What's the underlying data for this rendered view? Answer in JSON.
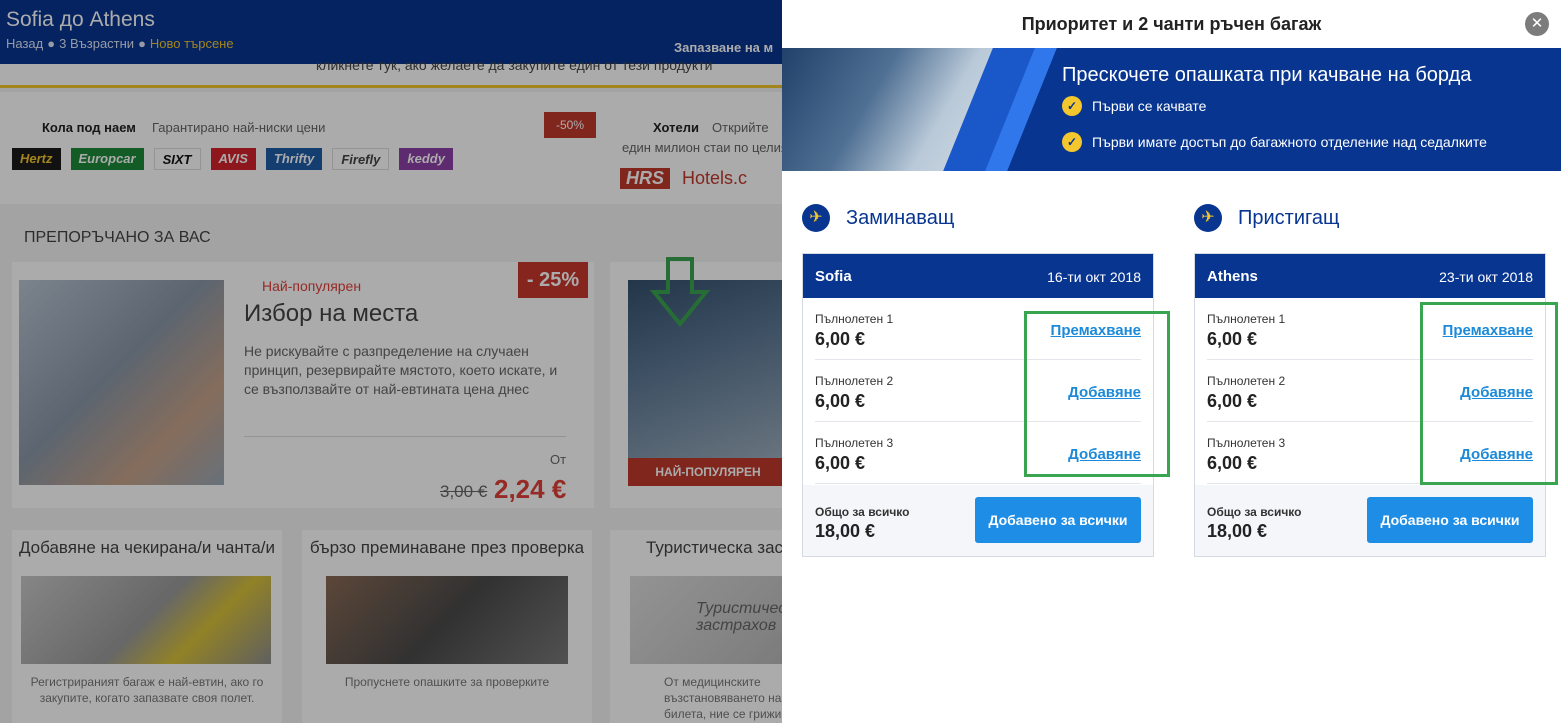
{
  "background": {
    "title": "Sofia до Athens",
    "crumbs": {
      "back": "Назад",
      "passengers": "3 Възрастни",
      "new_search": "Ново търсене"
    },
    "booking_label": "Запазване на м",
    "notice": "кликнете тук, ако желаете да закупите един от тези продукти",
    "car_hire": {
      "label": "Кола под наем",
      "subtitle": "Гарантирано най-ниски цени",
      "discount": "-50%",
      "brands": [
        {
          "name": "Hertz",
          "color": "#222222"
        },
        {
          "name": "Europcar",
          "color": "#1d8a3a"
        },
        {
          "name": "SIXT",
          "color": "#ffffff"
        },
        {
          "name": "AVIS",
          "color": "#d2232a"
        },
        {
          "name": "Thrifty",
          "color": "#1f5ba8"
        },
        {
          "name": "Firefly",
          "color": "#ffffff"
        },
        {
          "name": "keddy",
          "color": "#8c3fa8"
        }
      ]
    },
    "hotels": {
      "label": "Хотели",
      "subtitle": "Открийте",
      "subtitle2": "един милион стаи по целия",
      "logos": [
        "HRS",
        "Hotels.c"
      ]
    },
    "recommended_title": "ПРЕПОРЪЧАНО ЗА ВАС",
    "seat_card": {
      "badge": "Най-популярен",
      "discount": "- 25%",
      "title": "Избор на места",
      "description": "Не рискувайте с разпределение на случаен принцип, резервирайте мястото, което искате, и се възползвайте от най-евтината цена днес",
      "from_label": "От",
      "old_price": "3,00 €",
      "new_price": "2,24 €"
    },
    "bag_card": {
      "banner": "НАЙ-ПОПУЛЯРЕН"
    },
    "checked_bag_card": {
      "title": "Добавяне на чекирана/и чанта/и",
      "caption": "Регистрираният багаж е най-евтин, ако го закупите, когато запазвате своя полет."
    },
    "fast_track_card": {
      "title": "бързо преминаване през проверка",
      "caption": "Пропуснете опашките за проверките"
    },
    "insurance_card": {
      "title": "Туристическа зас",
      "caption": "От медицинските възстановяването на с билета, ние се грижи",
      "image_text": "Туристичес застрахов"
    }
  },
  "modal": {
    "title": "Приоритет и 2 чанти ръчен багаж",
    "close_label": "✕",
    "hero": {
      "headline": "Прескочете опашката при качване на борда",
      "benefits": [
        "Първи се качвате",
        "Първи имате достъп до багажното отделение над седалките"
      ]
    },
    "flights": [
      {
        "direction": "Заминаващ",
        "city": "Sofia",
        "date": "16-ти окт 2018",
        "passengers": [
          {
            "name": "Пълнолетен 1",
            "price": "6,00 €",
            "action": "Премахване"
          },
          {
            "name": "Пълнолетен 2",
            "price": "6,00 €",
            "action": "Добавяне"
          },
          {
            "name": "Пълнолетен 3",
            "price": "6,00 €",
            "action": "Добавяне"
          }
        ],
        "total_label": "Общо за всичко",
        "total": "18,00 €",
        "button": "Добавено за всички"
      },
      {
        "direction": "Пристигащ",
        "city": "Athens",
        "date": "23-ти окт 2018",
        "passengers": [
          {
            "name": "Пълнолетен 1",
            "price": "6,00 €",
            "action": "Премахване"
          },
          {
            "name": "Пълнолетен 2",
            "price": "6,00 €",
            "action": "Добавяне"
          },
          {
            "name": "Пълнолетен 3",
            "price": "6,00 €",
            "action": "Добавяне"
          }
        ],
        "total_label": "Общо за всичко",
        "total": "18,00 €",
        "button": "Добавено за всички"
      }
    ]
  },
  "colors": {
    "brand_blue": "#073590",
    "accent_yellow": "#f3c72d",
    "link_blue": "#1c8ad8",
    "button_blue": "#1e8de6",
    "highlight_green": "#3aa550",
    "sale_red": "#e0413a"
  }
}
